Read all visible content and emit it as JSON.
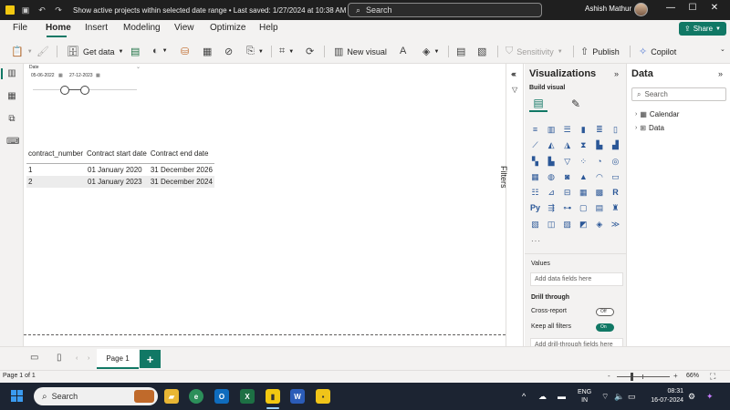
{
  "titlebar": {
    "title": "Show active projects within selected date range • Last saved: 1/27/2024 at 10:38 AM",
    "search_placeholder": "Search",
    "user_name": "Ashish Mathur",
    "minimize": "—",
    "restore": "☐",
    "close": "✕"
  },
  "menu": {
    "file": "File",
    "home": "Home",
    "insert": "Insert",
    "modeling": "Modeling",
    "view": "View",
    "optimize": "Optimize",
    "help": "Help",
    "share": "Share"
  },
  "ribbon": {
    "get_data": "Get data",
    "new_visual": "New visual",
    "sensitivity": "Sensitivity",
    "publish": "Publish",
    "copilot": "Copilot"
  },
  "slicer": {
    "title": "Date",
    "start_date": "05-06-2022",
    "end_date": "27-12-2023"
  },
  "table": {
    "headers": [
      "contract_number",
      "Contract start date",
      "Contract end date"
    ],
    "rows": [
      [
        "1",
        "01 January 2020",
        "31 December 2026"
      ],
      [
        "2",
        "01 January 2023",
        "31 December 2024"
      ]
    ]
  },
  "filters": {
    "label": "Filters"
  },
  "visualizations": {
    "title": "Visualizations",
    "build_visual": "Build visual",
    "more": "···",
    "values_label": "Values",
    "values_placeholder": "Add data fields here",
    "drill_through": "Drill through",
    "cross_report": "Cross-report",
    "cross_report_state": "Off",
    "keep_all_filters": "Keep all filters",
    "keep_all_filters_state": "On",
    "drill_placeholder": "Add drill-through fields here"
  },
  "data_pane": {
    "title": "Data",
    "search_placeholder": "Search",
    "tables": [
      "Calendar",
      "Data"
    ]
  },
  "pages": {
    "active": "Page 1",
    "add": "+"
  },
  "status": {
    "page_indicator": "Page 1 of 1",
    "zoom": "66%"
  },
  "taskbar": {
    "search": "Search",
    "lang_line1": "ENG",
    "lang_line2": "IN",
    "time": "08:31",
    "date": "16-07-2024"
  },
  "colors": {
    "accent": "#117865",
    "titlebar": "#1f1f1f",
    "taskbar": "#1c2432"
  }
}
